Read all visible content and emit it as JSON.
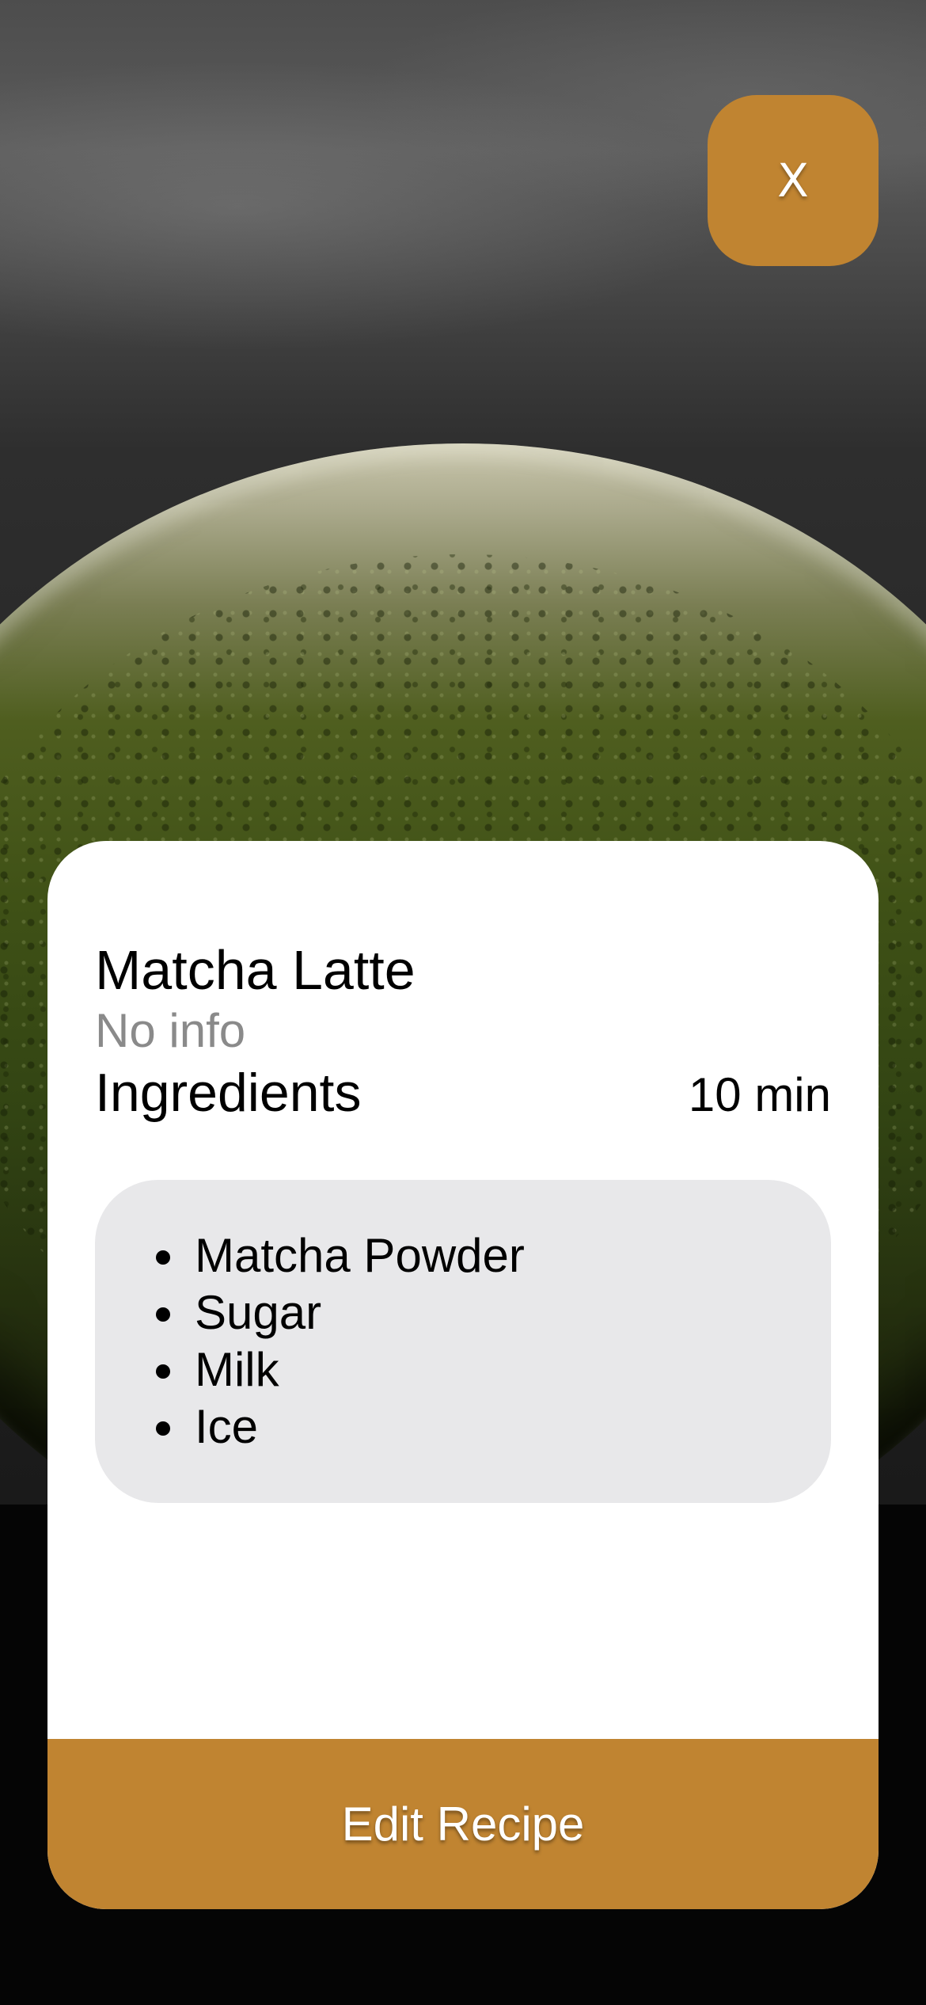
{
  "colors": {
    "accent": "#C08431",
    "card_background": "#FFFFFF",
    "ingredients_background": "#E8E8EA",
    "subtitle_text": "#8A8A8A"
  },
  "hero": {
    "image_description_icon": "matcha-latte-photo"
  },
  "close_button": {
    "label": "X"
  },
  "recipe": {
    "title": "Matcha Latte",
    "subtitle": "No info",
    "ingredients_heading": "Ingredients",
    "time": "10 min",
    "ingredients": [
      "Matcha Powder",
      "Sugar",
      "Milk",
      "Ice"
    ]
  },
  "actions": {
    "edit_label": "Edit Recipe"
  }
}
